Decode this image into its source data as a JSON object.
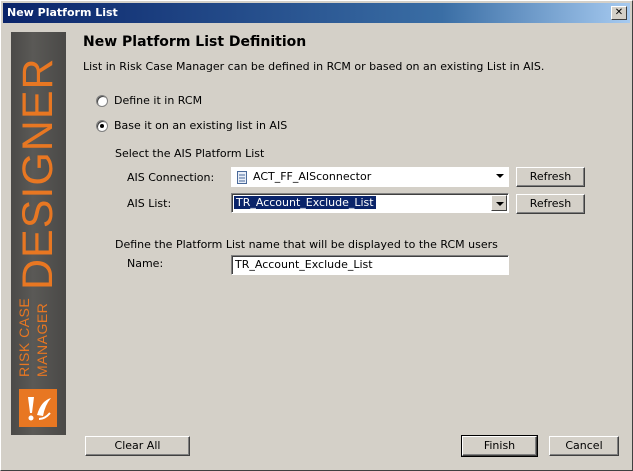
{
  "window": {
    "title": "New Platform List",
    "close_symbol": "✕"
  },
  "banner": {
    "line1": "RISK CASE",
    "line2": "MANAGER",
    "product": "DESIGNER",
    "brand_color": "#e87722"
  },
  "header": {
    "title": "New Platform List Definition",
    "description": "List in Risk Case Manager can be defined in RCM or based on an existing List in AIS."
  },
  "options": {
    "define_rcm": {
      "label": "Define it in RCM",
      "selected": false
    },
    "base_ais": {
      "label": "Base it on an existing list in AIS",
      "selected": true
    }
  },
  "ais_section": {
    "title": "Select the AIS Platform List",
    "connection_label": "AIS Connection:",
    "connection_value": "ACT_FF_AISconnector",
    "list_label": "AIS List:",
    "list_value": "TR_Account_Exclude_List",
    "refresh_label": "Refresh"
  },
  "name_section": {
    "title": "Define the Platform List name that will be displayed to the RCM users",
    "name_label": "Name:",
    "name_value": "TR_Account_Exclude_List"
  },
  "footer": {
    "clear_label": "Clear All",
    "finish_label": "Finish",
    "cancel_label": "Cancel"
  },
  "icons": {
    "connection": "database-icon",
    "logo": "rcm-logo-icon"
  }
}
